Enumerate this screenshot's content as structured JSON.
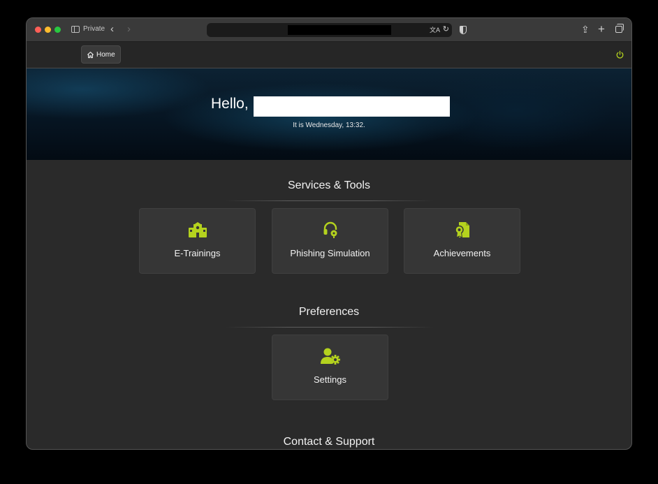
{
  "browser": {
    "private_label": "Private",
    "back_glyph": "‹",
    "forward_glyph": "›",
    "share_glyph": "⇪",
    "newtab_glyph": "+",
    "reload_glyph": "↻",
    "translate_glyph": "文A"
  },
  "nav": {
    "home_label": "Home",
    "home_icon": "home-icon",
    "power_icon": "power-icon"
  },
  "hero": {
    "greeting": "Hello,",
    "datetime": "It is Wednesday, 13:32."
  },
  "sections": {
    "services": {
      "title": "Services & Tools",
      "cards": [
        {
          "label": "E-Trainings",
          "icon": "school-icon"
        },
        {
          "label": "Phishing Simulation",
          "icon": "headset-icon"
        },
        {
          "label": "Achievements",
          "icon": "certificate-icon"
        }
      ]
    },
    "preferences": {
      "title": "Preferences",
      "cards": [
        {
          "label": "Settings",
          "icon": "user-gear-icon"
        }
      ]
    },
    "contact": {
      "title": "Contact & Support"
    }
  },
  "colors": {
    "accent": "#b4d21e",
    "background": "#2a2a2a",
    "card": "#363636"
  }
}
